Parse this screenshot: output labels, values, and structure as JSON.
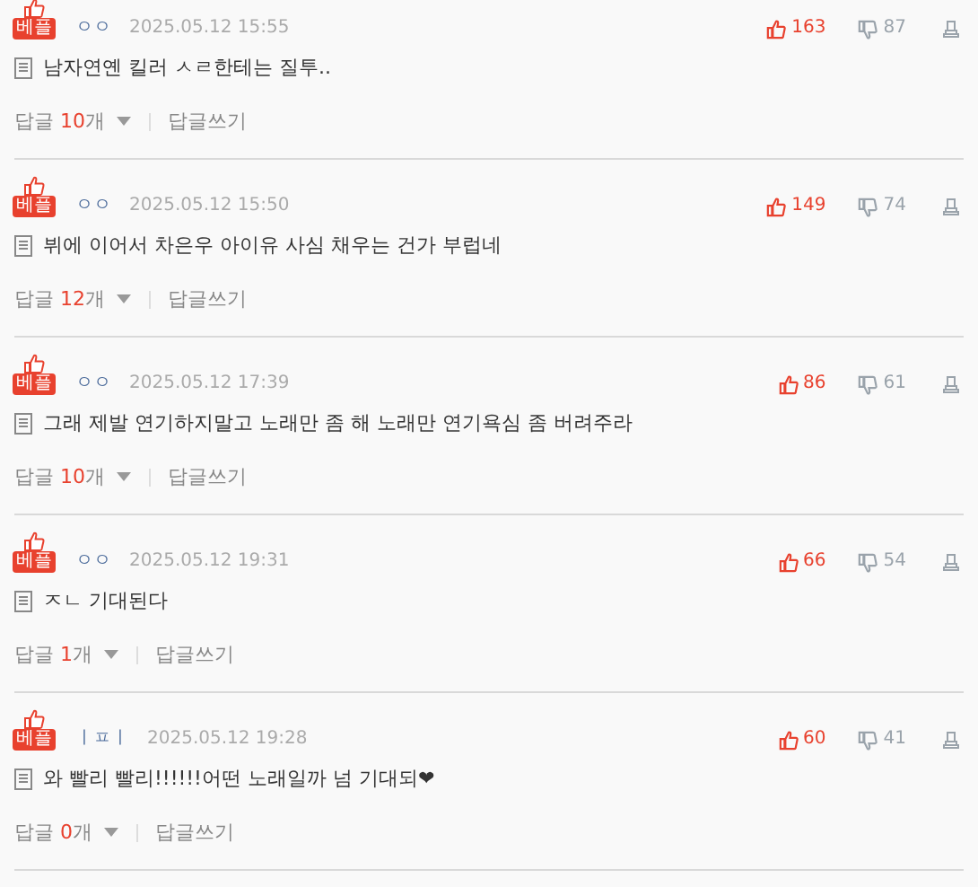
{
  "comments": [
    {
      "badge": "베플",
      "author": "ㅇㅇ",
      "date": "2025.05.12 15:55",
      "likes": "163",
      "dislikes": "87",
      "text": "남자연옌 킬러 ㅅㄹ한테는 질투..",
      "reply_label": "답글",
      "reply_count": "10",
      "reply_unit": "개",
      "write_reply": "답글쓰기"
    },
    {
      "badge": "베플",
      "author": "ㅇㅇ",
      "date": "2025.05.12 15:50",
      "likes": "149",
      "dislikes": "74",
      "text": "뷔에 이어서 차은우 아이유 사심 채우는 건가 부럽네",
      "reply_label": "답글",
      "reply_count": "12",
      "reply_unit": "개",
      "write_reply": "답글쓰기"
    },
    {
      "badge": "베플",
      "author": "ㅇㅇ",
      "date": "2025.05.12 17:39",
      "likes": "86",
      "dislikes": "61",
      "text": "그래 제발 연기하지말고 노래만 좀 해 노래만 연기욕심 좀 버려주라",
      "reply_label": "답글",
      "reply_count": "10",
      "reply_unit": "개",
      "write_reply": "답글쓰기"
    },
    {
      "badge": "베플",
      "author": "ㅇㅇ",
      "date": "2025.05.12 19:31",
      "likes": "66",
      "dislikes": "54",
      "text": "ㅈㄴ 기대된다",
      "reply_label": "답글",
      "reply_count": "1",
      "reply_unit": "개",
      "write_reply": "답글쓰기"
    },
    {
      "badge": "베플",
      "author": "ㅣㅍㅣ",
      "date": "2025.05.12 19:28",
      "likes": "60",
      "dislikes": "41",
      "text": "와 빨리 빨리!!!!!!어떤 노래일까 넘 기대되❤",
      "reply_label": "답글",
      "reply_count": "0",
      "reply_unit": "개",
      "write_reply": "답글쓰기"
    }
  ]
}
